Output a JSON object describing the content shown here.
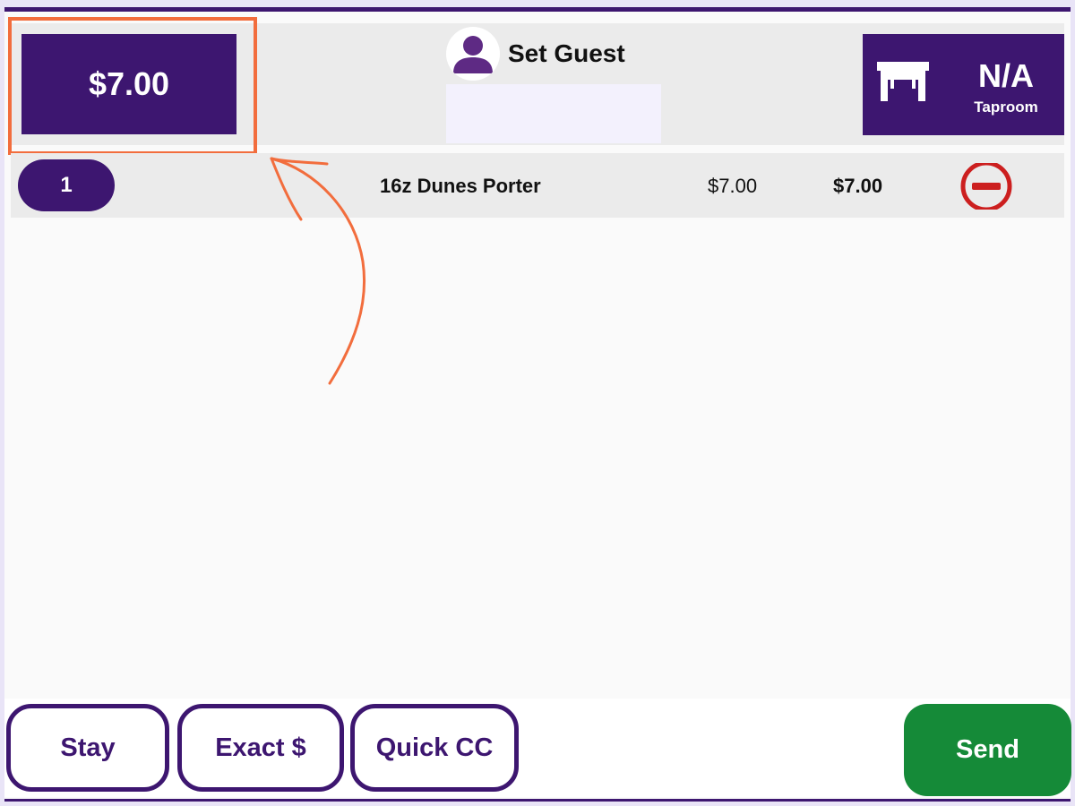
{
  "header": {
    "order_total": "$7.00",
    "guest": {
      "label": "Set Guest",
      "field_value": ""
    },
    "table": {
      "name": "N/A",
      "area": "Taproom"
    }
  },
  "order": {
    "lines": [
      {
        "quantity": "1",
        "item": "16z Dunes Porter",
        "unit_price": "$7.00",
        "line_total": "$7.00"
      }
    ]
  },
  "footer": {
    "buttons": {
      "stay": "Stay",
      "exact": "Exact $",
      "quick_cc": "Quick CC",
      "send": "Send"
    }
  },
  "icons": {
    "guest": "user-silhouette-icon",
    "table": "table-icon",
    "remove": "minus-circle-icon"
  },
  "colors": {
    "brand_purple": "#3d1670",
    "send_green": "#158a38",
    "remove_red": "#cc1f1f",
    "annotation_orange": "#f26d3d"
  }
}
